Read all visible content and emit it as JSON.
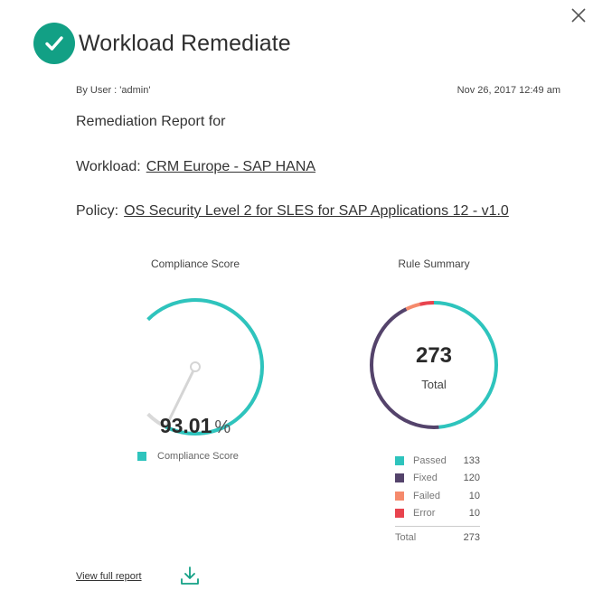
{
  "header": {
    "title": "Workload Remediate"
  },
  "meta": {
    "user": "By User : 'admin'",
    "date": "Nov 26, 2017 12:49 am"
  },
  "report": {
    "heading": "Remediation Report for",
    "workload_label": "Workload:",
    "workload_value": "CRM Europe - SAP HANA",
    "policy_label": "Policy:",
    "policy_value": "OS Security Level 2 for SLES for SAP Applications 12 - v1.0"
  },
  "compliance": {
    "title": "Compliance Score",
    "score": "93.01",
    "unit": "%",
    "legend_label": "Compliance Score",
    "score_fraction": 0.9301,
    "color": "#2ec4bd"
  },
  "rule_summary": {
    "title": "Rule Summary",
    "total": "273",
    "total_label": "Total",
    "legend_total_label": "Total",
    "items": [
      {
        "label": "Passed",
        "value": "133",
        "color": "#2ec4bd"
      },
      {
        "label": "Fixed",
        "value": "120",
        "color": "#54436b"
      },
      {
        "label": "Failed",
        "value": "10",
        "color": "#f58a6c"
      },
      {
        "label": "Error",
        "value": "10",
        "color": "#e8434e"
      }
    ]
  },
  "footer": {
    "view_report": "View full report"
  },
  "icons": {
    "close": "close-icon",
    "check": "check-icon",
    "download": "download-icon"
  },
  "colors": {
    "accent": "#12a085",
    "gauge_track": "#d9d9d9"
  }
}
